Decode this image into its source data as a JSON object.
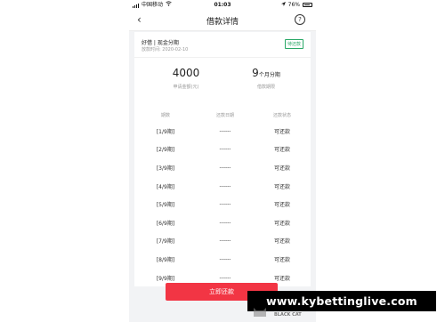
{
  "status_bar": {
    "carrier": "中国移动",
    "time": "01:03",
    "battery_percent": "76%"
  },
  "nav": {
    "title": "借款详情",
    "help": "?"
  },
  "loan": {
    "name": "好借 | 现金分期",
    "date_text": "放款时间: 2020-02-10",
    "badge": "待还款",
    "amount_value": "4000",
    "amount_label": "申请金额(元)",
    "term_value": "9",
    "term_unit": "个月分期",
    "term_label": "借款期限"
  },
  "plan": {
    "headers": [
      "期数",
      "还款日期",
      "还款状态"
    ],
    "rows": [
      {
        "period": "[1/9期]",
        "date": "------",
        "status": "可还款"
      },
      {
        "period": "[2/9期]",
        "date": "------",
        "status": "可还款"
      },
      {
        "period": "[3/9期]",
        "date": "------",
        "status": "可还款"
      },
      {
        "period": "[4/9期]",
        "date": "------",
        "status": "可还款"
      },
      {
        "period": "[5/9期]",
        "date": "------",
        "status": "可还款"
      },
      {
        "period": "[6/9期]",
        "date": "------",
        "status": "可还款"
      },
      {
        "period": "[7/9期]",
        "date": "------",
        "status": "可还款"
      },
      {
        "period": "[8/9期]",
        "date": "------",
        "status": "可还款"
      },
      {
        "period": "[9/9期]",
        "date": "------",
        "status": "可还款"
      }
    ]
  },
  "pay_button": "立即还款",
  "watermark": {
    "url": "www.kybettinglive.com",
    "brand": "BLACK CAT"
  },
  "colors": {
    "accent": "#f23544",
    "badge": "#2aa867",
    "watermark_bg": "#000000"
  },
  "icons": {
    "back": "chevron-left-icon",
    "help": "question-circle-icon",
    "wifi": "wifi-icon",
    "battery": "battery-icon",
    "location": "location-arrow-icon"
  }
}
